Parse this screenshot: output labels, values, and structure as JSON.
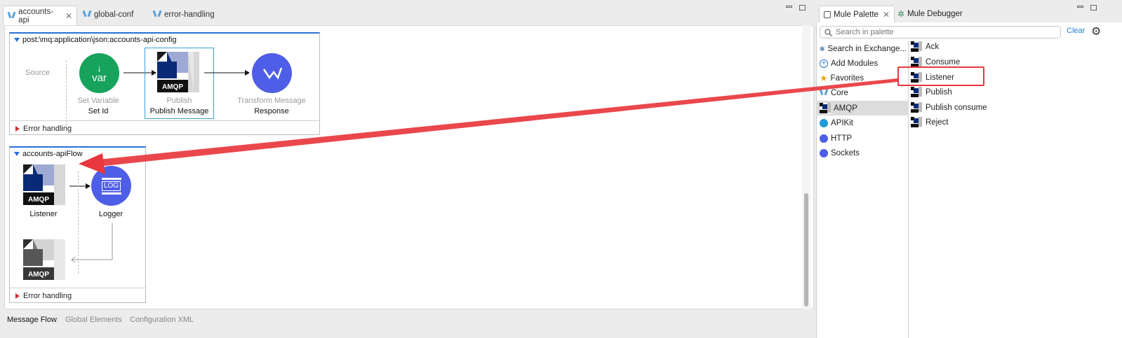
{
  "editor": {
    "tabs": [
      {
        "label": "accounts-api",
        "active": true
      },
      {
        "label": "global-conf",
        "active": false
      },
      {
        "label": "error-handling",
        "active": false
      }
    ],
    "bottom_tabs": [
      "Message Flow",
      "Global Elements",
      "Configuration XML"
    ]
  },
  "flow1": {
    "title": "post:\\mq:application\\json:accounts-api-config",
    "source_label": "Source",
    "components": [
      {
        "type": "Set Variable",
        "name": "Set Id",
        "icon": "var-icon",
        "color": "#17a35c"
      },
      {
        "type": "Publish",
        "name": "Publish Message",
        "icon": "amqp-icon",
        "selected": true
      },
      {
        "type": "Transform Message",
        "name": "Response",
        "icon": "transform-icon",
        "color": "#4f5ee6"
      }
    ],
    "error_handling": "Error handling"
  },
  "flow2": {
    "title": "accounts-apiFlow",
    "components": [
      {
        "name": "Listener",
        "icon": "amqp-icon"
      },
      {
        "name": "Logger",
        "icon": "log-icon",
        "icon_text": "LOG",
        "color": "#4f5ee6"
      }
    ],
    "error_handling": "Error handling"
  },
  "amqp_text": "AMQP",
  "palette": {
    "tabs": [
      {
        "label": "Mule Palette",
        "active": true
      },
      {
        "label": "Mule Debugger",
        "active": false
      }
    ],
    "search_placeholder": "Search in palette",
    "clear_label": "Clear",
    "categories": [
      {
        "label": "Search in Exchange...",
        "icon": "exchange-icon"
      },
      {
        "label": "Add Modules",
        "icon": "add-icon"
      },
      {
        "label": "Favorites",
        "icon": "star-icon"
      },
      {
        "label": "Core",
        "icon": "mule-icon"
      },
      {
        "label": "AMQP",
        "icon": "amqp-icon",
        "selected": true
      },
      {
        "label": "APIKit",
        "icon": "apikit-icon"
      },
      {
        "label": "HTTP",
        "icon": "http-icon"
      },
      {
        "label": "Sockets",
        "icon": "sockets-icon"
      }
    ],
    "operations": [
      {
        "label": "Ack"
      },
      {
        "label": "Consume"
      },
      {
        "label": "Listener",
        "highlighted": true
      },
      {
        "label": "Publish"
      },
      {
        "label": "Publish consume"
      },
      {
        "label": "Reject"
      }
    ]
  },
  "colors": {
    "accent": "#2a6fd6",
    "annotation": "#e8373d",
    "amqp_navy": "#0a2a78"
  }
}
